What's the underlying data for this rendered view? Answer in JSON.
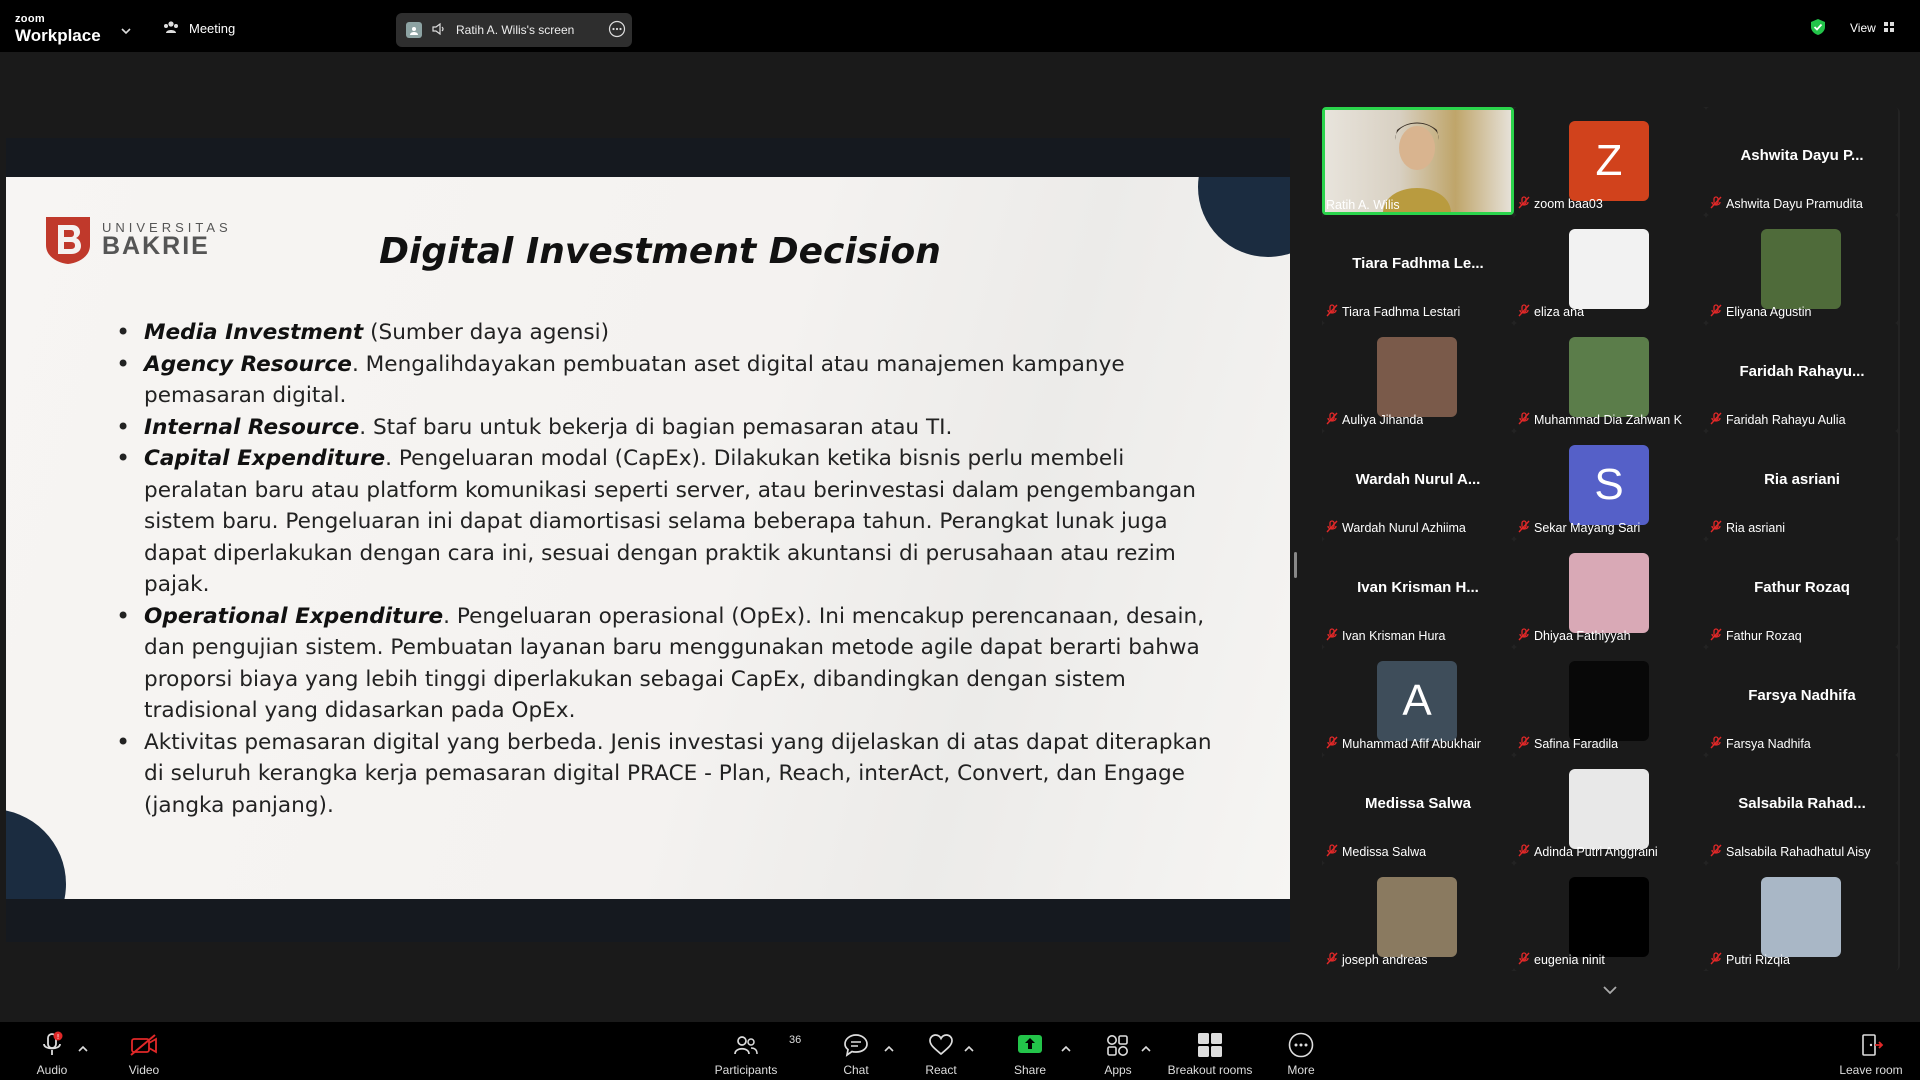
{
  "app": {
    "brand_top": "zoom",
    "brand_bottom": "Workplace",
    "meeting_label": "Meeting",
    "share_label": "Ratih A. Wilis's screen",
    "view_label": "View"
  },
  "slide": {
    "logo_line1": "UNIVERSITAS",
    "logo_line2": "BAKRIE",
    "title": "Digital Investment Decision",
    "bullets": [
      {
        "term": "Media Investment",
        "text": " (Sumber daya agensi)"
      },
      {
        "term": "Agency Resource",
        "text": ". Mengalihdayakan pembuatan aset digital atau manajemen kampanye pemasaran digital."
      },
      {
        "term": "Internal Resource",
        "text": ". Staf baru untuk bekerja di bagian pemasaran atau TI."
      },
      {
        "term": "Capital Expenditure",
        "text": ". Pengeluaran modal (CapEx). Dilakukan ketika bisnis perlu membeli peralatan baru atau platform komunikasi seperti server, atau berinvestasi dalam pengembangan sistem baru. Pengeluaran ini dapat diamortisasi selama beberapa tahun. Perangkat lunak juga dapat diperlakukan dengan cara ini, sesuai dengan praktik akuntansi di perusahaan atau rezim pajak."
      },
      {
        "term": "Operational Expenditure",
        "text": ". Pengeluaran operasional (OpEx). Ini mencakup perencanaan, desain, dan pengujian sistem. Pembuatan layanan baru menggunakan metode agile dapat berarti bahwa proporsi biaya yang lebih tinggi diperlakukan sebagai CapEx, dibandingkan dengan sistem tradisional yang didasarkan pada OpEx."
      },
      {
        "term": "",
        "text": "Aktivitas pemasaran digital yang berbeda. Jenis investasi yang dijelaskan di atas dapat diterapkan di seluruh kerangka kerja pemasaran digital PRACE - Plan, Reach, interAct, Convert, dan Engage (jangka panjang)."
      }
    ]
  },
  "participants": [
    {
      "label": "Ratih A. Wilis",
      "kind": "video",
      "active": true,
      "color": "#c9b48a"
    },
    {
      "label": "zoom baa03",
      "kind": "avatar",
      "letter": "Z",
      "color": "#d1421c"
    },
    {
      "label": "Ashwita Dayu Pramudita",
      "kind": "name",
      "big": "Ashwita Dayu P..."
    },
    {
      "label": "Tiara Fadhma Lestari",
      "kind": "name",
      "big": "Tiara Fadhma Le..."
    },
    {
      "label": "eliza ana",
      "kind": "photo",
      "color": "#f2f2f2"
    },
    {
      "label": "Eliyana Agustin",
      "kind": "photo",
      "color": "#4f6b3a"
    },
    {
      "label": "Auliya Jihanda",
      "kind": "photo",
      "color": "#7a5a4a"
    },
    {
      "label": "Muhammad Dia Zahwan K",
      "kind": "photo",
      "color": "#5b7d4a"
    },
    {
      "label": "Faridah Rahayu Aulia",
      "kind": "name",
      "big": "Faridah  Rahayu..."
    },
    {
      "label": "Wardah Nurul Azhiima",
      "kind": "name",
      "big": "Wardah  Nurul  A..."
    },
    {
      "label": "Sekar Mayang Sari",
      "kind": "avatar",
      "letter": "S",
      "color": "#5560c8"
    },
    {
      "label": "Ria asriani",
      "kind": "name",
      "big": "Ria asriani"
    },
    {
      "label": "Ivan  Krisman Hura",
      "kind": "name",
      "big": "Ivan  Krisman  H..."
    },
    {
      "label": "Dhiyaa Fathiyyah",
      "kind": "photo",
      "color": "#d9a9b6"
    },
    {
      "label": "Fathur Rozaq",
      "kind": "name",
      "big": "Fathur Rozaq"
    },
    {
      "label": "Muhammad Afif Abukhair",
      "kind": "avatar",
      "letter": "A",
      "color": "#3e4d5a"
    },
    {
      "label": "Safina Faradila",
      "kind": "photo",
      "color": "#080808"
    },
    {
      "label": "Farsya Nadhifa",
      "kind": "name",
      "big": "Farsya Nadhifa"
    },
    {
      "label": "Medissa Salwa",
      "kind": "name",
      "big": "Medissa Salwa"
    },
    {
      "label": "Adinda Putri Anggraini",
      "kind": "photo",
      "color": "#e8e8e8"
    },
    {
      "label": "Salsabila Rahadhatul Aisy",
      "kind": "name",
      "big": "Salsabila  Rahad..."
    },
    {
      "label": "joseph andreas",
      "kind": "photo",
      "color": "#8a7a60"
    },
    {
      "label": "eugenia ninit",
      "kind": "photo",
      "color": "#000000"
    },
    {
      "label": "Putri Rizqia",
      "kind": "photo",
      "color": "#a9b7c6"
    }
  ],
  "toolbar": {
    "audio": "Audio",
    "video": "Video",
    "participants": "Participants",
    "participants_count": "36",
    "chat": "Chat",
    "react": "React",
    "share": "Share",
    "apps": "Apps",
    "breakout": "Breakout rooms",
    "more": "More",
    "leave": "Leave room"
  },
  "colors": {
    "accent_green": "#2bd44c",
    "share_green": "#23c44a",
    "muted_red": "#e02828"
  }
}
